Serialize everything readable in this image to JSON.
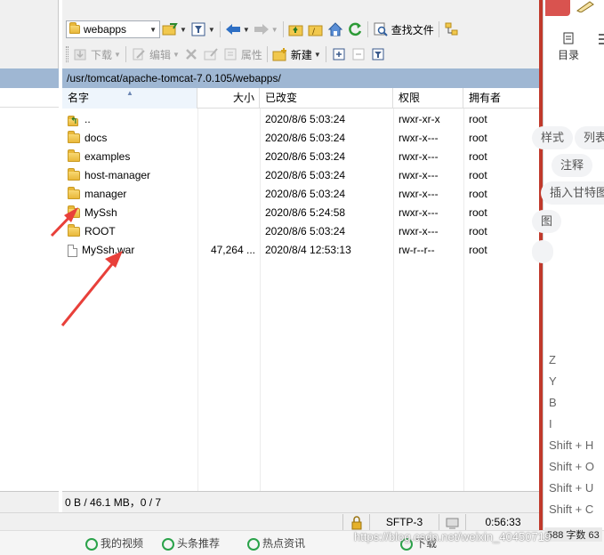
{
  "toolbar": {
    "path_combo": "webapps",
    "find_files_label": "查找文件",
    "download_label": "下载",
    "edit_label": "编辑",
    "properties_label": "属性",
    "new_label": "新建"
  },
  "remote_path": "/usr/tomcat/apache-tomcat-7.0.105/webapps/",
  "columns": {
    "name": "名字",
    "size": "大小",
    "modified": "已改变",
    "permissions": "权限",
    "owner": "拥有者"
  },
  "files": [
    {
      "name": "..",
      "size": "",
      "modified": "2020/8/6 5:03:24",
      "permissions": "rwxr-xr-x",
      "owner": "root",
      "icon": "parent-dir-icon"
    },
    {
      "name": "docs",
      "size": "",
      "modified": "2020/8/6 5:03:24",
      "permissions": "rwxr-x---",
      "owner": "root",
      "icon": "folder-icon"
    },
    {
      "name": "examples",
      "size": "",
      "modified": "2020/8/6 5:03:24",
      "permissions": "rwxr-x---",
      "owner": "root",
      "icon": "folder-icon"
    },
    {
      "name": "host-manager",
      "size": "",
      "modified": "2020/8/6 5:03:24",
      "permissions": "rwxr-x---",
      "owner": "root",
      "icon": "folder-icon"
    },
    {
      "name": "manager",
      "size": "",
      "modified": "2020/8/6 5:03:24",
      "permissions": "rwxr-x---",
      "owner": "root",
      "icon": "folder-icon"
    },
    {
      "name": "MySsh",
      "size": "",
      "modified": "2020/8/6 5:24:58",
      "permissions": "rwxr-x---",
      "owner": "root",
      "icon": "folder-icon"
    },
    {
      "name": "ROOT",
      "size": "",
      "modified": "2020/8/6 5:03:24",
      "permissions": "rwxr-x---",
      "owner": "root",
      "icon": "folder-icon"
    },
    {
      "name": "MySsh.war",
      "size": "47,264 ...",
      "modified": "2020/8/4 12:53:13",
      "permissions": "rw-r--r--",
      "owner": "root",
      "icon": "file-icon"
    }
  ],
  "status": {
    "selection": "0 B / 46.1 MB，0 / 7",
    "protocol": "SFTP-3",
    "timer": "0:56:33"
  },
  "right_panel": {
    "directory_label": "目录",
    "pills": [
      "样式",
      "列表",
      "注释",
      "插入甘特图",
      "图",
      ""
    ],
    "shortcuts": [
      "Z",
      "Y",
      "B",
      "I",
      "Shift + H",
      "Shift + O",
      "Shift + U",
      "Shift + C"
    ],
    "word_count": "588 字数 63"
  },
  "taskbar": {
    "items": [
      "我的视频",
      "头条推荐",
      "热点资讯",
      "下载"
    ]
  },
  "watermark": "https://blog.csdn.net/weixin_40450719",
  "colors": {
    "path_bar": "#9fb7d3",
    "annotation_arrow": "#e8403a",
    "accent_red": "#c0392b"
  }
}
